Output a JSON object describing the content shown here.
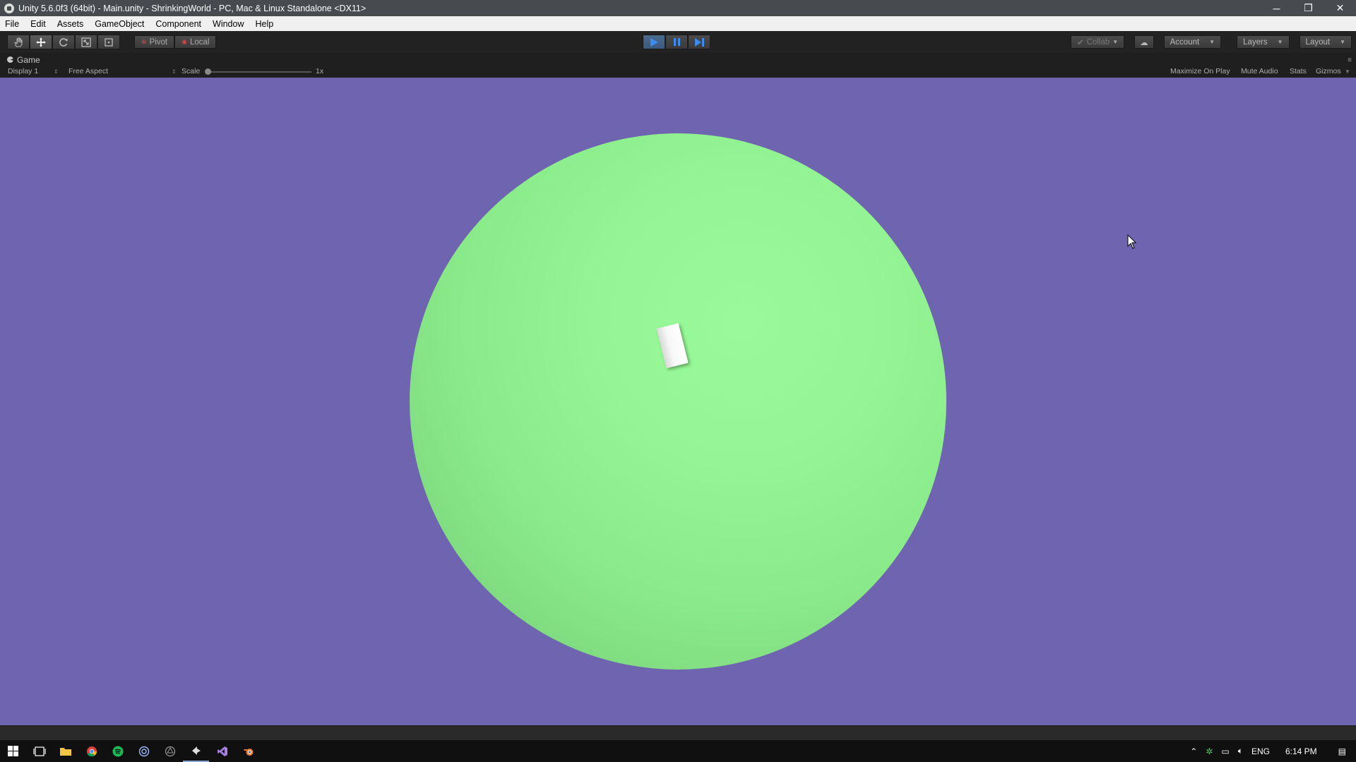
{
  "window": {
    "title": "Unity 5.6.0f3 (64bit) - Main.unity - ShrinkingWorld - PC, Mac & Linux Standalone <DX11>",
    "minimize": "─",
    "restore": "❐",
    "close": "✕"
  },
  "menu": [
    "File",
    "Edit",
    "Assets",
    "GameObject",
    "Component",
    "Window",
    "Help"
  ],
  "toolbar": {
    "pivot_label": "Pivot",
    "local_label": "Local",
    "collab_label": "Collab",
    "account_label": "Account",
    "layers_label": "Layers",
    "layout_label": "Layout"
  },
  "game_tab": {
    "title": "Game",
    "display": "Display 1",
    "aspect": "Free Aspect",
    "scale_label": "Scale",
    "scale_value": "1x",
    "maximize_on_play": "Maximize On Play",
    "mute_audio": "Mute Audio",
    "stats": "Stats",
    "gizmos": "Gizmos"
  },
  "taskbar": {
    "language": "ENG",
    "time": "6:14 PM"
  },
  "colors": {
    "game_background": "#6f64af",
    "planet": "#93f593",
    "play_accent": "#3d8df0"
  }
}
